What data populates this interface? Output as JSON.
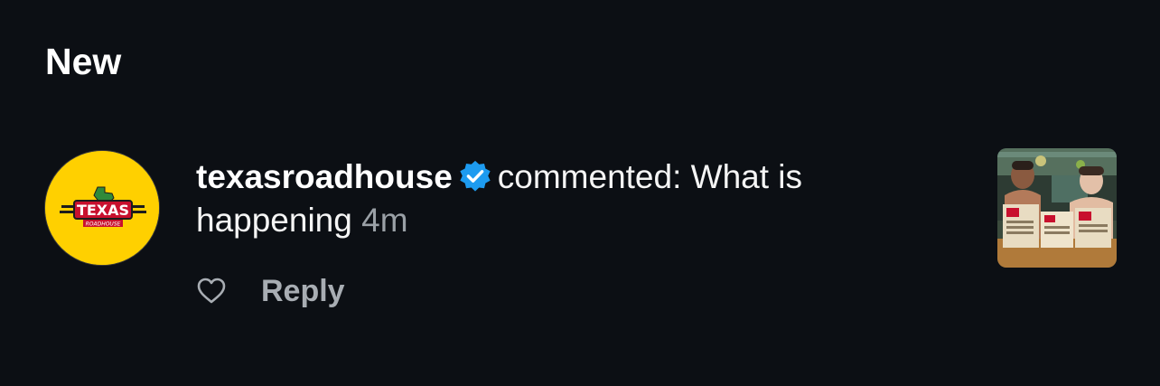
{
  "section": {
    "title": "New"
  },
  "notification": {
    "username": "texasroadhouse",
    "action_text": "commented: What is happening",
    "time": "4m",
    "reply_label": "Reply",
    "avatar_logo_text": "TEXAS",
    "avatar_logo_subtext": "ROADHOUSE",
    "verified_icon": "verified-badge-icon",
    "like_icon": "heart-outline-icon"
  },
  "colors": {
    "background": "#0c0f14",
    "avatar_bg": "#ffd000",
    "verified_blue": "#1d9bf0",
    "muted_text": "#9aa0a6"
  }
}
